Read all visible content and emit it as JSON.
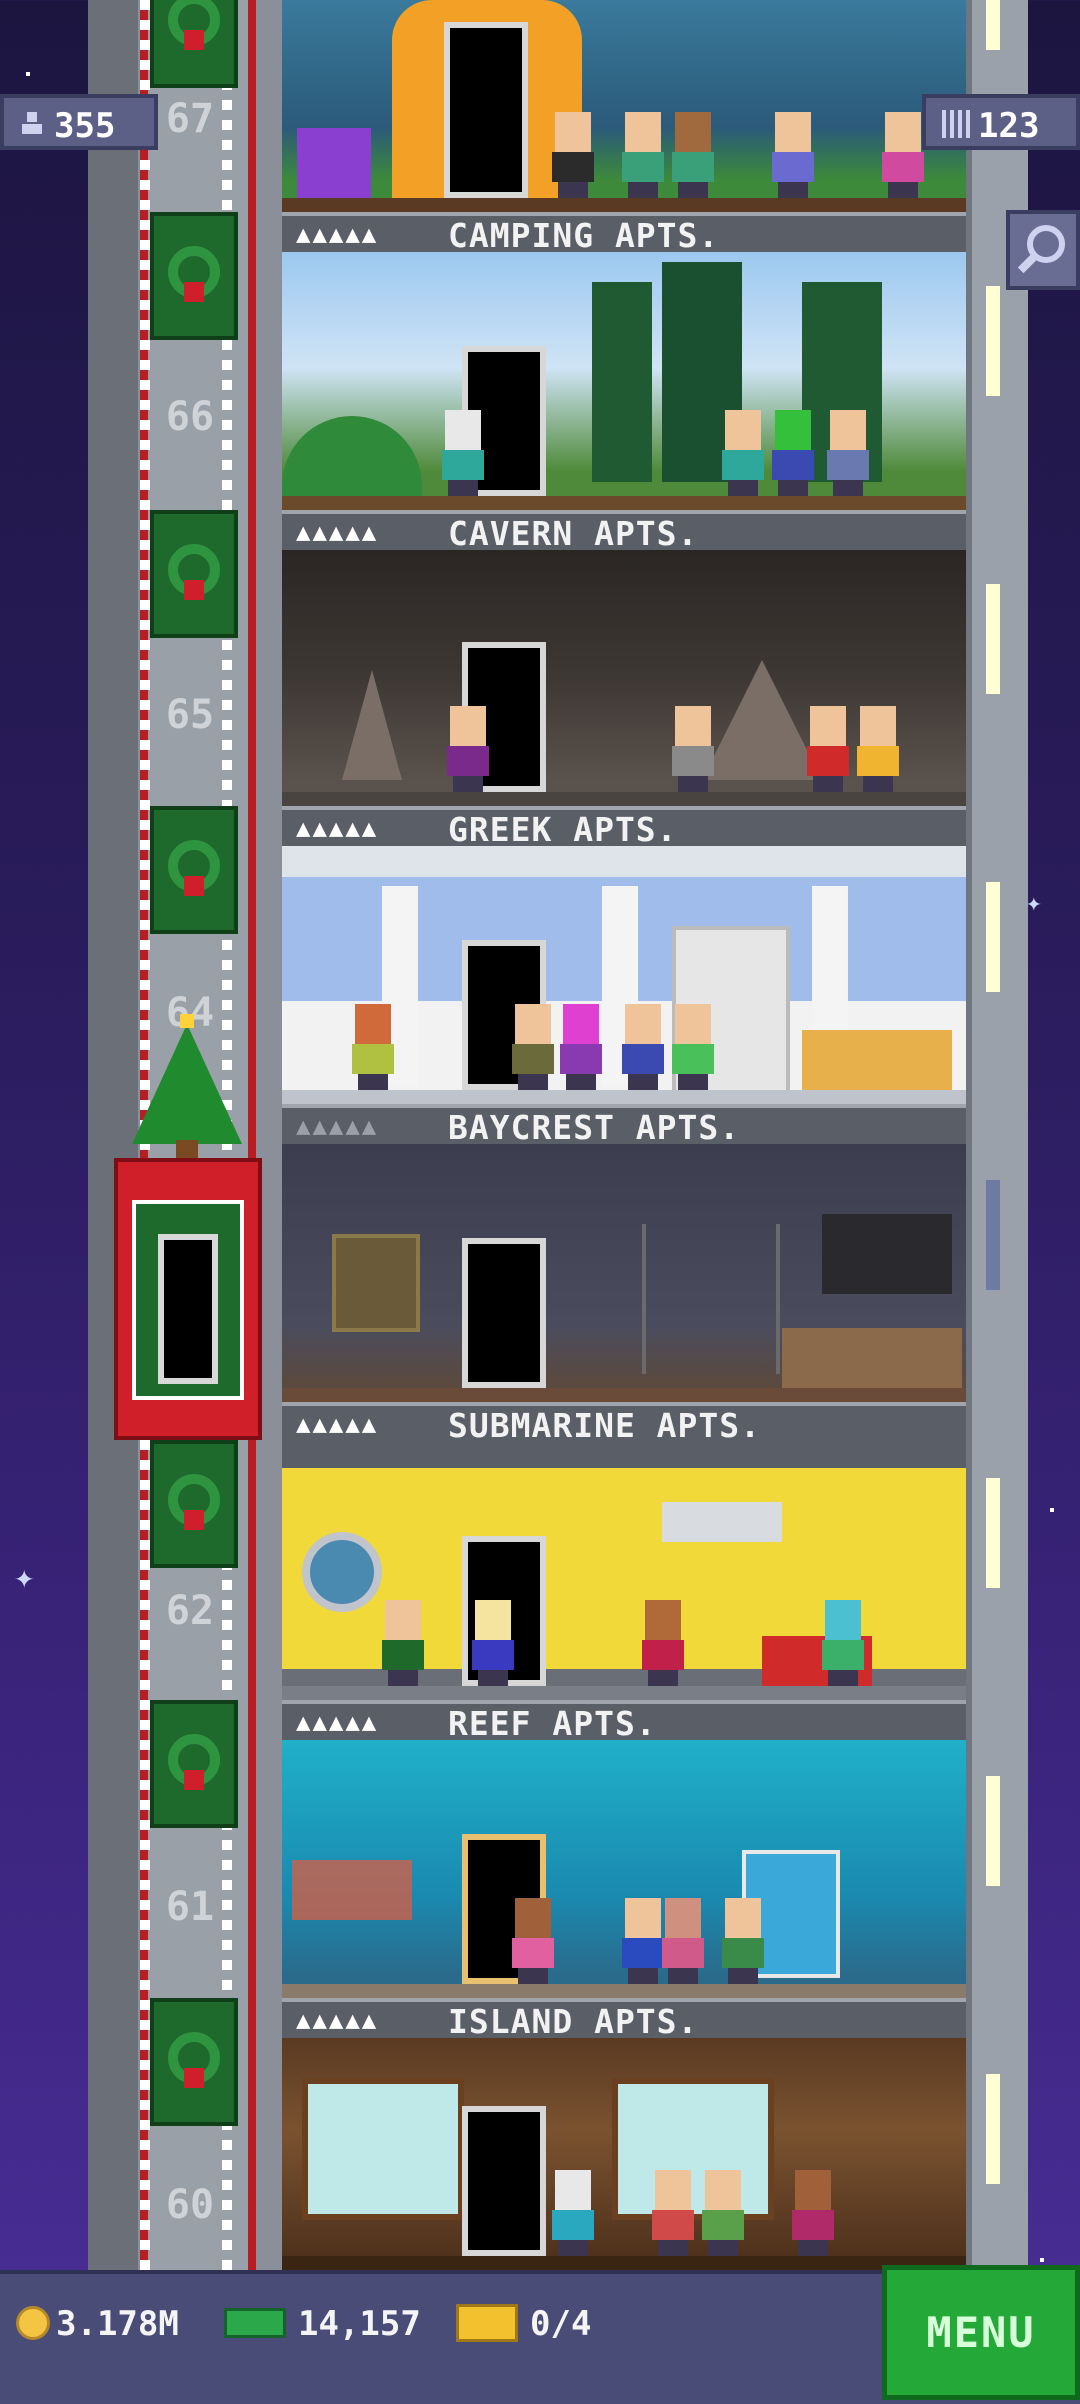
{
  "hud": {
    "population": "355",
    "floor_count": "123"
  },
  "shaft_numbers": [
    "67",
    "66",
    "65",
    "64",
    "62",
    "61",
    "60"
  ],
  "floors": [
    {
      "name": "CAMPING APTS.",
      "stars": "▲▲▲▲▲",
      "stars_lit": true
    },
    {
      "name": "CAVERN APTS.",
      "stars": "▲▲▲▲▲",
      "stars_lit": true
    },
    {
      "name": "GREEK APTS.",
      "stars": "▲▲▲▲▲",
      "stars_lit": true
    },
    {
      "name": "BAYCREST APTS.",
      "stars": "▲▲▲▲▲",
      "stars_lit": false
    },
    {
      "name": "SUBMARINE APTS.",
      "stars": "▲▲▲▲▲",
      "stars_lit": true
    },
    {
      "name": "REEF APTS.",
      "stars": "▲▲▲▲▲",
      "stars_lit": true
    },
    {
      "name": "ISLAND APTS.",
      "stars": "▲▲▲▲▲",
      "stars_lit": true
    }
  ],
  "bottom_bar": {
    "coins": "3.178M",
    "bux": "14,157",
    "tickets": "0/4",
    "menu_label": "MENU"
  },
  "icons": {
    "population": "person-icon",
    "floors": "building-grid-icon",
    "search": "magnifier-icon",
    "coins": "coin-icon",
    "bux": "bux-icon",
    "tickets": "ticket-icon"
  },
  "colors": {
    "sky_top": "#1c1540",
    "sky_bottom": "#4a2e96",
    "elevator": "#d11f29",
    "menu_button": "#24a838"
  }
}
